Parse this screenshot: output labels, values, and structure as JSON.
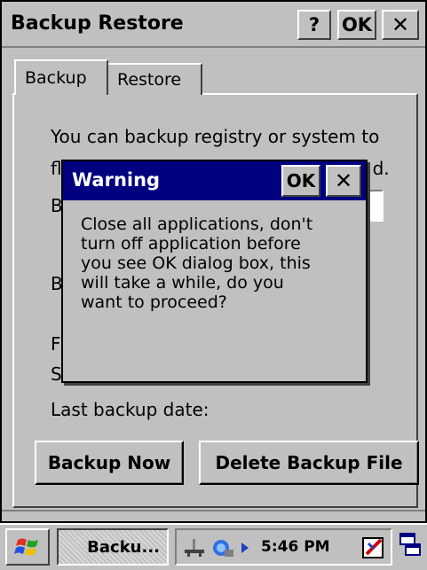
{
  "window": {
    "title": "Backup Restore",
    "help_label": "?",
    "ok_label": "OK",
    "close_label": "✕"
  },
  "tabs": [
    {
      "label": "Backup",
      "active": true
    },
    {
      "label": "Restore",
      "active": false
    }
  ],
  "backup_panel": {
    "description_line1": "You can backup registry or system to",
    "description_line2_start": "fl",
    "description_line2_end": "d.",
    "label_1": "B",
    "label_2": "B",
    "free_label": "F",
    "selected_label": "S",
    "last_backup_label": "Last backup date:",
    "backup_now_label": "Backup Now",
    "delete_backup_label": "Delete Backup File"
  },
  "warning_dialog": {
    "title": "Warning",
    "ok_label": "OK",
    "close_label": "✕",
    "message": "Close all applications, don't\nturn off application before\nyou see OK dialog box, this\nwill take a while, do you\nwant to proceed?"
  },
  "taskbar": {
    "task_label": "Backu...",
    "clock": "5:46 PM"
  },
  "colors": {
    "dialog_title_bg": "#000080",
    "face": "#c0c0c0"
  }
}
